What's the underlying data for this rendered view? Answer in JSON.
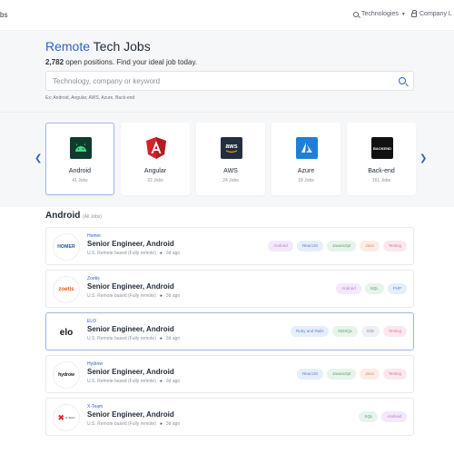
{
  "topbar": {
    "brand_fragment": "bs",
    "technologies_label": "Technologies",
    "company_label": "Company L"
  },
  "hero": {
    "title_accent": "Remote",
    "title_rest": " Tech Jobs",
    "count": "2,782",
    "subtitle_rest": " open positions. Find your ideal job today.",
    "search_placeholder": "Technology, company or keyword",
    "examples": "Ex: Android, Angular, AWS, Azure, Back-end"
  },
  "technologies": [
    {
      "name": "Android",
      "count": "41 Jobs",
      "icon": "android-icon",
      "color": "#0f3b2e"
    },
    {
      "name": "Angular",
      "count": "22 Jobs",
      "icon": "angular-icon",
      "color": "#d2232a"
    },
    {
      "name": "AWS",
      "count": "24 Jobs",
      "icon": "aws-icon",
      "color": "#232f3e"
    },
    {
      "name": "Azure",
      "count": "18 Jobs",
      "icon": "azure-icon",
      "color": "#1f7fd6"
    },
    {
      "name": "Back-end",
      "count": "161 Jobs",
      "icon": "backend-icon",
      "color": "#111111"
    }
  ],
  "section": {
    "title": "Android",
    "subtitle": "(All Jobs)"
  },
  "jobs": [
    {
      "company": "Homer",
      "title": "Senior Engineer, Android",
      "location": "U.S. Remote based (Fully remote)",
      "age": "3d ago",
      "logo_text": "HOMER",
      "tags": [
        "Android",
        "ReactJS",
        "Javascript",
        "Java",
        "Testing"
      ]
    },
    {
      "company": "Zoetis",
      "title": "Senior Engineer, Android",
      "location": "U.S. Remote based (Fully remote)",
      "age": "3d ago",
      "logo_text": "zoetis",
      "tags": [
        "Android",
        "SQL",
        "PHP"
      ]
    },
    {
      "company": "ELO",
      "title": "Senior Engineer, Android",
      "location": "U.S. Remote based (Fully remote)",
      "age": "3d ago",
      "logo_text": "elo",
      "tags": [
        "Ruby and Rails",
        "NOSQL",
        "iOS",
        "Testing"
      ]
    },
    {
      "company": "Hydrow",
      "title": "Senior Engineer, Android",
      "location": "U.S. Remote based (Fully remote)",
      "age": "3d ago",
      "logo_text": "hydrow",
      "tags": [
        "ReactJS",
        "Javascript",
        "Java",
        "Testing"
      ]
    },
    {
      "company": "X-Team",
      "title": "Senior Engineer, Android",
      "location": "U.S. Remote based (Fully remote)",
      "age": "3d ago",
      "logo_text": "X-Team",
      "tags": [
        "SQL",
        "Android"
      ]
    }
  ],
  "colors": {
    "accent": "#2a63c9",
    "hero_bg": "#f6f7f9"
  }
}
